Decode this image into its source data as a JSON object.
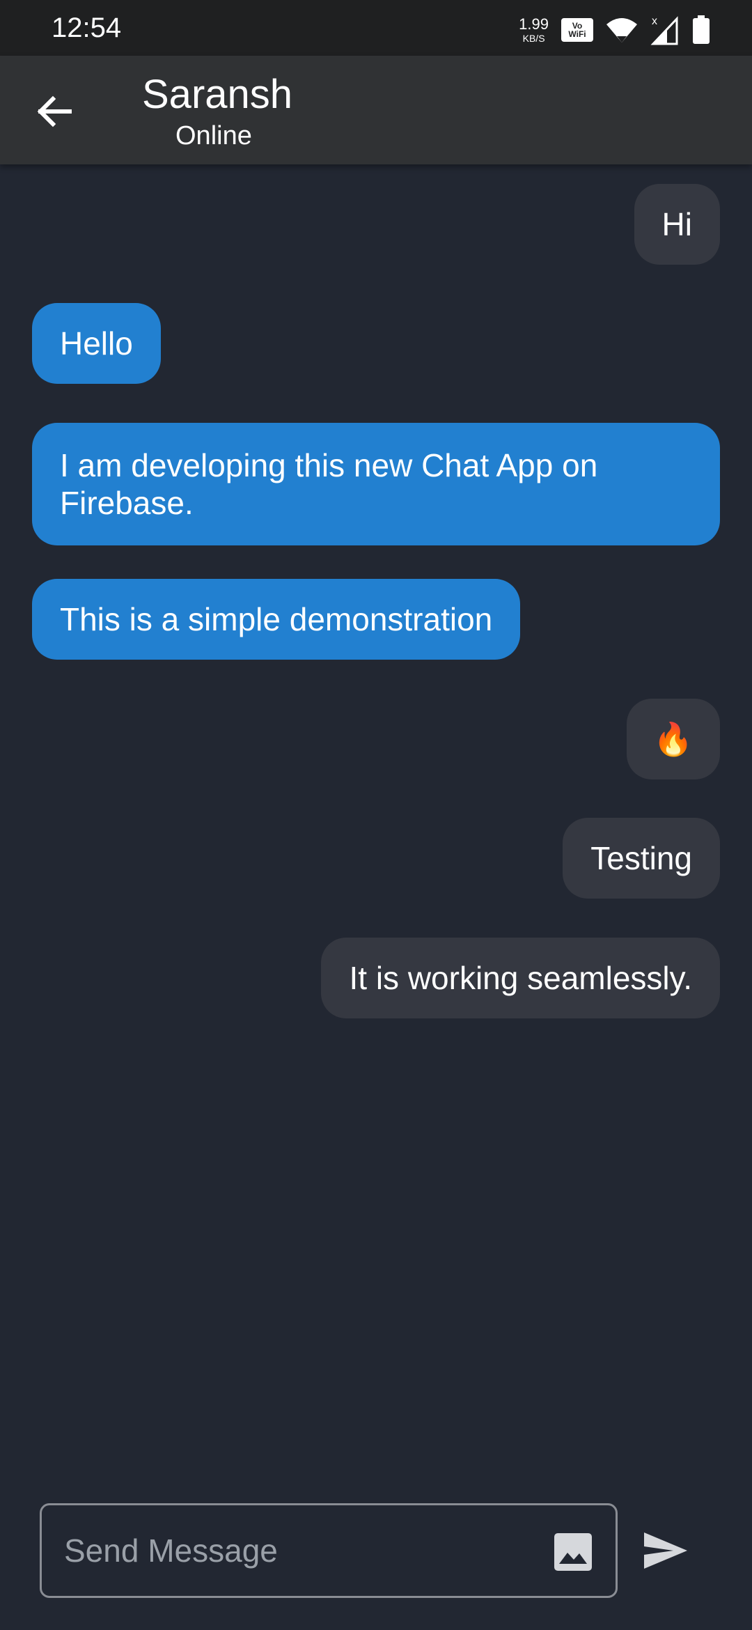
{
  "status_bar": {
    "time": "12:54",
    "net_speed_value": "1.99",
    "net_speed_unit": "KB/S",
    "vowifi_top": "Vo",
    "vowifi_bottom": "WiFi"
  },
  "header": {
    "contact_name": "Saransh",
    "contact_status": "Online",
    "back_icon": "arrow-left-icon"
  },
  "messages": [
    {
      "text": "Hi",
      "side": "sent"
    },
    {
      "text": "Hello",
      "side": "received"
    },
    {
      "text": "I am developing this new Chat App on Firebase.",
      "side": "received"
    },
    {
      "text": "This is a simple demonstration",
      "side": "received"
    },
    {
      "text": "🔥",
      "side": "sent"
    },
    {
      "text": "Testing",
      "side": "sent"
    },
    {
      "text": "It is working seamlessly.",
      "side": "sent"
    }
  ],
  "composer": {
    "placeholder": "Send Message",
    "image_icon": "image-icon",
    "send_icon": "send-icon"
  },
  "colors": {
    "background": "#222732",
    "app_bar": "#303234",
    "sent_bubble": "#353841",
    "received_bubble": "#2280d0"
  }
}
